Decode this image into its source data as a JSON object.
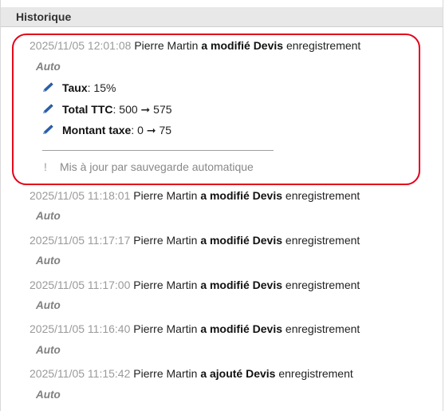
{
  "panel": {
    "title": "Historique"
  },
  "entries": [
    {
      "timestamp": "2025/11/05 12:01:08",
      "user": "Pierre Martin",
      "action": "a modifié Devis",
      "object": "enregistrement",
      "source": "Auto",
      "changes": [
        {
          "field": "Taux",
          "value": ": 15%"
        },
        {
          "field": "Total TTC",
          "from": ": 500",
          "arrow": "➞",
          "to": "575"
        },
        {
          "field": "Montant taxe",
          "from": ": 0",
          "arrow": "➞",
          "to": "75"
        }
      ],
      "note": "Mis à jour par sauvegarde automatique",
      "note_icon": "!"
    },
    {
      "timestamp": "2025/11/05 11:18:01",
      "user": "Pierre Martin",
      "action": "a modifié Devis",
      "object": "enregistrement",
      "source": "Auto"
    },
    {
      "timestamp": "2025/11/05 11:17:17",
      "user": "Pierre Martin",
      "action": "a modifié Devis",
      "object": "enregistrement",
      "source": "Auto"
    },
    {
      "timestamp": "2025/11/05 11:17:00",
      "user": "Pierre Martin",
      "action": "a modifié Devis",
      "object": "enregistrement",
      "source": "Auto"
    },
    {
      "timestamp": "2025/11/05 11:16:40",
      "user": "Pierre Martin",
      "action": "a modifié Devis",
      "object": "enregistrement",
      "source": "Auto"
    },
    {
      "timestamp": "2025/11/05 11:15:42",
      "user": "Pierre Martin",
      "action": "a ajouté Devis",
      "object": "enregistrement",
      "source": "Auto"
    }
  ],
  "colors": {
    "highlight": "#e3001b",
    "pencil": "#2a5fa8",
    "header_bg": "#e8e8e8"
  },
  "icons": {
    "edit": "pencil-icon",
    "info": "exclamation-icon"
  }
}
